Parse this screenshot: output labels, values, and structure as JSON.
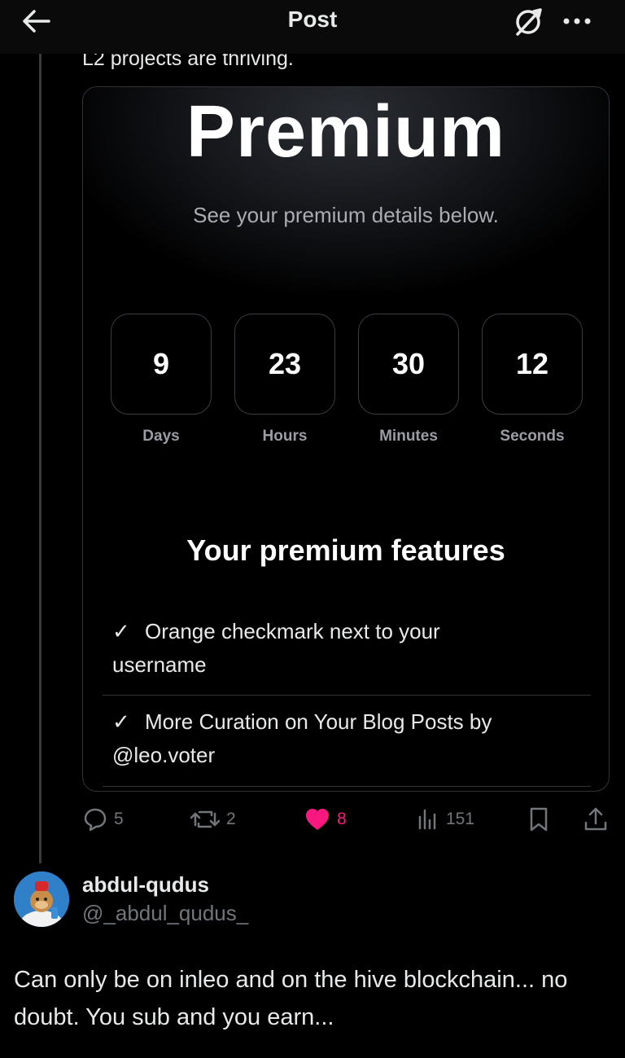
{
  "header": {
    "title": "Post",
    "back_icon": "arrow-left-icon",
    "brand_icon": "inleo-logo-icon",
    "more_icon": "more-horizontal-icon"
  },
  "post": {
    "text_fragment": "L2 projects are thriving."
  },
  "card": {
    "title": "Premium",
    "subtitle": "See your premium details below.",
    "countdown": [
      {
        "value": "9",
        "label": "Days"
      },
      {
        "value": "23",
        "label": "Hours"
      },
      {
        "value": "30",
        "label": "Minutes"
      },
      {
        "value": "12",
        "label": "Seconds"
      }
    ],
    "features_title": "Your premium features",
    "features": [
      {
        "line1": "Orange checkmark next to your",
        "line2": "username"
      },
      {
        "line1": "More Curation on Your Blog Posts by",
        "line2": "@leo.voter"
      }
    ],
    "check_glyph": "✓"
  },
  "actions": {
    "comments": "5",
    "reposts": "2",
    "likes": "8",
    "views": "151",
    "like_color": "#f91880"
  },
  "reply": {
    "name": "abdul-qudus",
    "handle": "@_abdul_qudus_",
    "text": "Can only be on inleo and on the hive blockchain... no doubt. You sub and you earn..."
  }
}
